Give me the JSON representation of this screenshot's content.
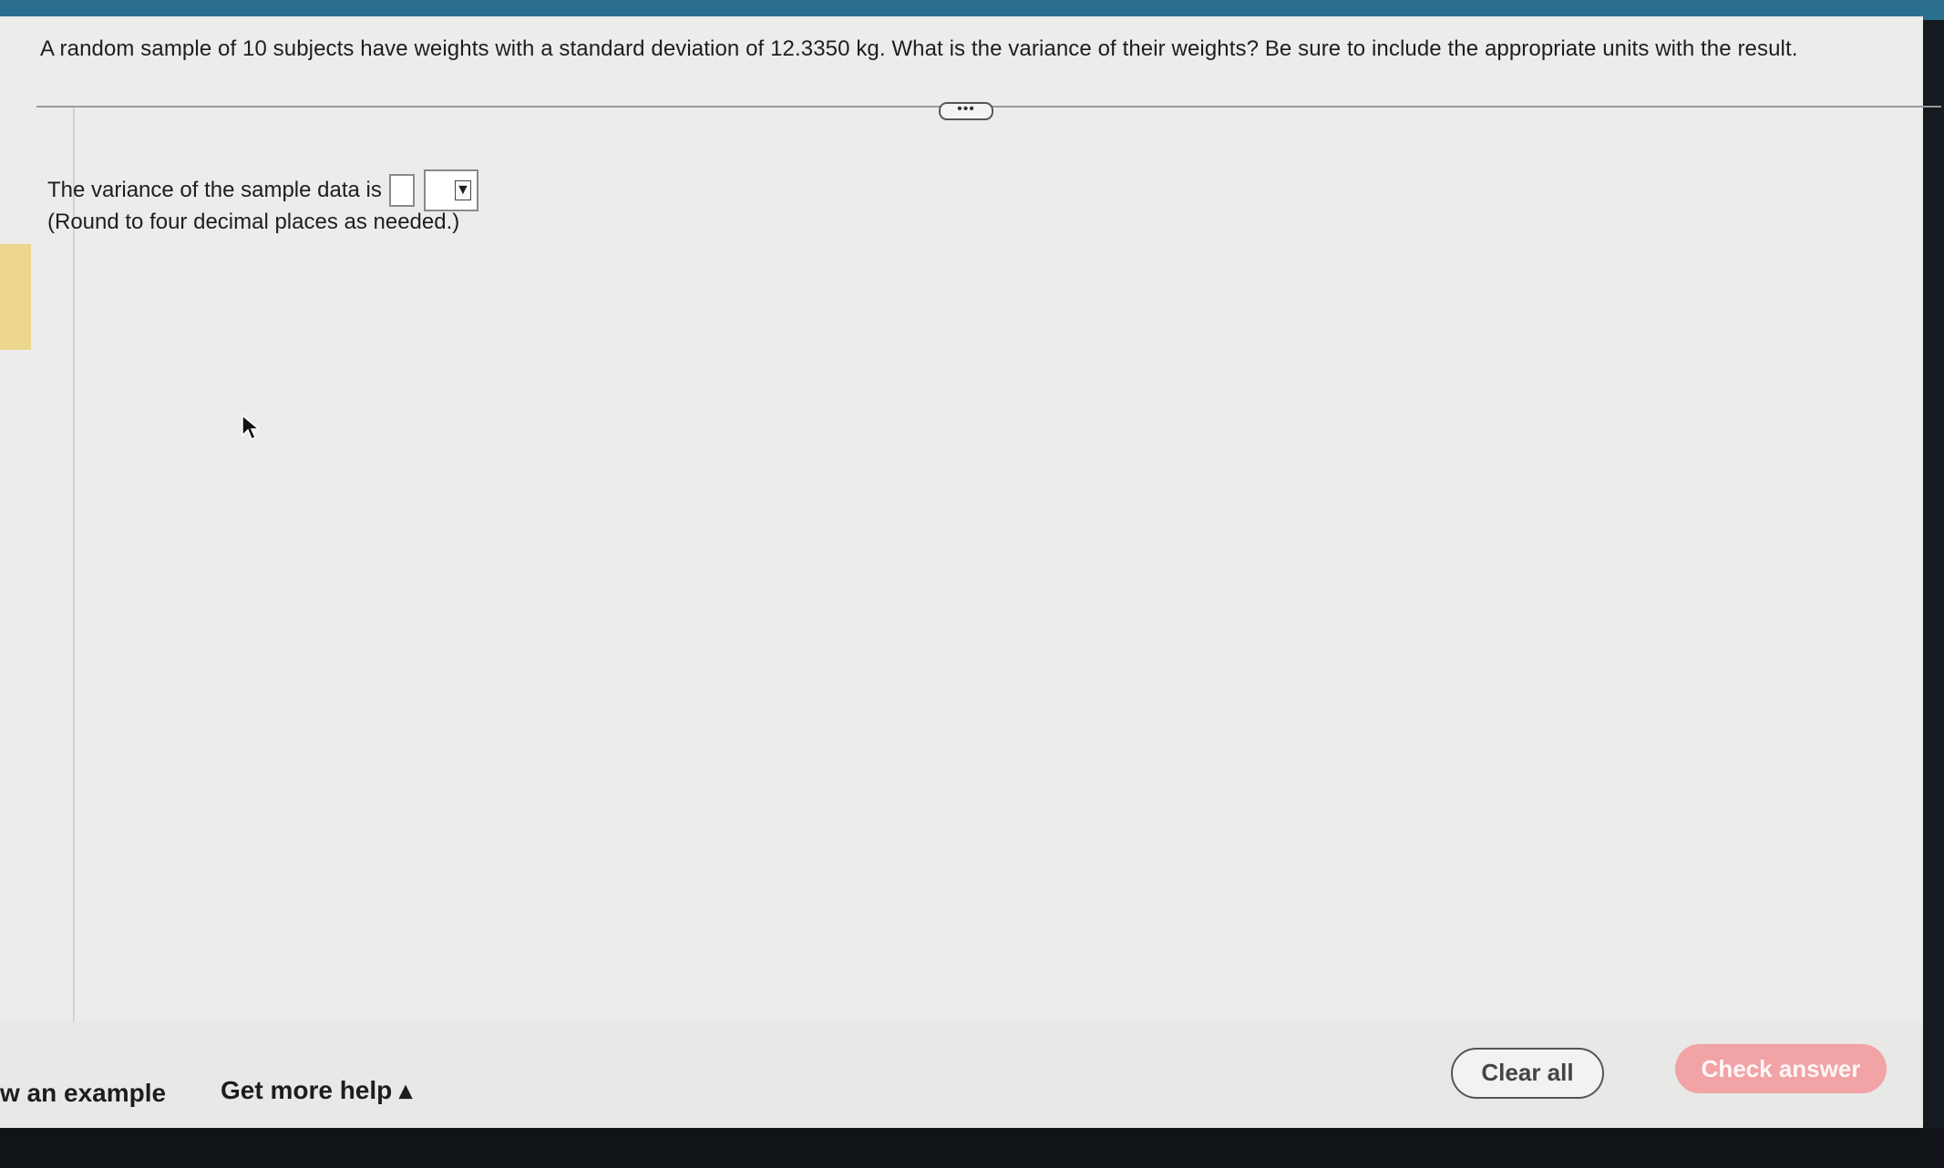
{
  "question": {
    "text": "A random sample of 10 subjects have weights with a standard deviation of 12.3350 kg. What is the variance of their weights? Be sure to include the appropriate units with the result."
  },
  "more_button": {
    "label": "•••"
  },
  "answer": {
    "prompt": "The variance of the sample data is",
    "value": "",
    "unit_selected": "",
    "hint": "(Round to four decimal places as needed.)"
  },
  "footer": {
    "view_example": "w an example",
    "get_more_help": "Get more help ▴",
    "clear_all": "Clear all",
    "check_answer": "Check answer"
  },
  "colors": {
    "check_answer_bg": "#f1a3a6",
    "top_bar": "#2a6f8f",
    "side_accent": "#ecd68e"
  },
  "icons": [
    "dropdown-arrow-icon",
    "mouse-cursor-icon"
  ]
}
